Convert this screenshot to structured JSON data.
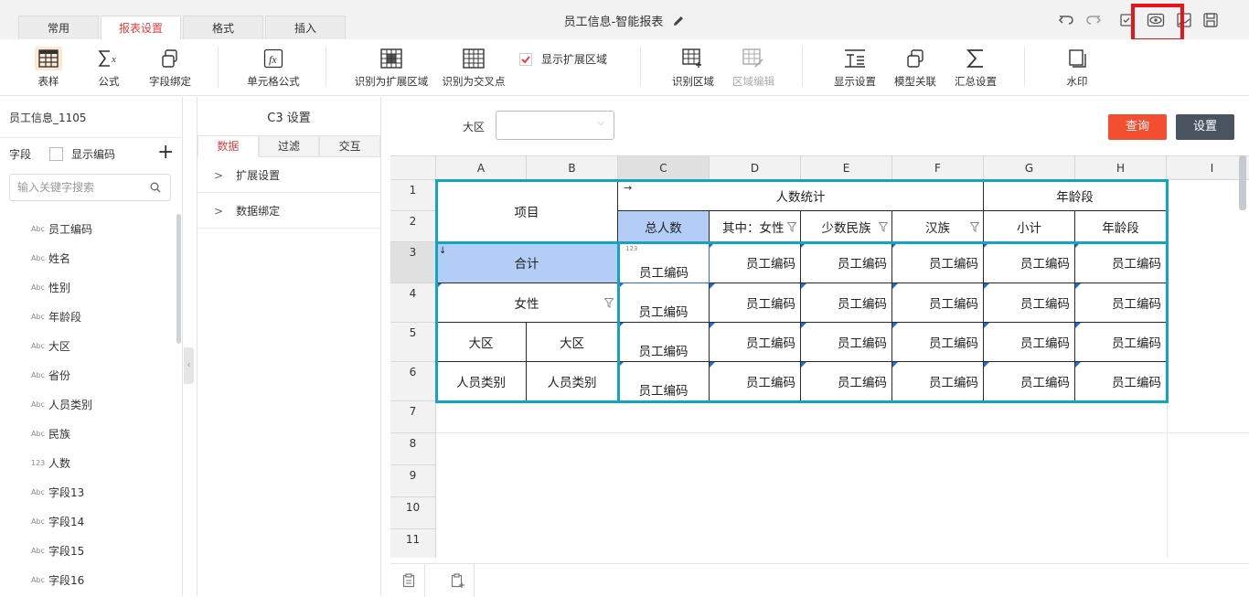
{
  "tabs": [
    {
      "label": "常用",
      "active": false
    },
    {
      "label": "报表设置",
      "active": true
    },
    {
      "label": "格式",
      "active": false
    },
    {
      "label": "插入",
      "active": false
    }
  ],
  "doc_title": "员工信息-智能报表",
  "top_right_icons": [
    "undo-icon",
    "redo-icon",
    "check-box-icon",
    "preview-eye-icon",
    "export-image-icon",
    "save-icon"
  ],
  "toolbar": {
    "items": [
      {
        "label": "表样",
        "icon": "table-style-icon"
      },
      {
        "label": "公式",
        "icon": "formula-icon"
      },
      {
        "label": "字段绑定",
        "icon": "field-bind-icon"
      },
      {
        "label": "单元格公式",
        "icon": "cell-formula-icon"
      },
      {
        "label": "识别为扩展区域",
        "icon": "expand-region-icon"
      },
      {
        "label": "识别为交叉点",
        "icon": "cross-point-icon"
      },
      {
        "label": "识别区域",
        "icon": "identify-region-icon"
      },
      {
        "label": "区域编辑",
        "icon": "region-edit-icon",
        "disabled": true
      },
      {
        "label": "显示设置",
        "icon": "display-settings-icon"
      },
      {
        "label": "模型关联",
        "icon": "model-link-icon"
      },
      {
        "label": "汇总设置",
        "icon": "summary-icon"
      },
      {
        "label": "水印",
        "icon": "watermark-icon"
      }
    ],
    "show_expand_area_label": "显示扩展区域",
    "show_expand_area_checked": true
  },
  "left_panel": {
    "title": "员工信息_1105",
    "field_label": "字段",
    "show_code_label": "显示编码",
    "search_placeholder": "输入关键字搜索",
    "fields": [
      {
        "type": "Abc",
        "name": "员工编码"
      },
      {
        "type": "Abc",
        "name": "姓名"
      },
      {
        "type": "Abc",
        "name": "性别"
      },
      {
        "type": "Abc",
        "name": "年龄段"
      },
      {
        "type": "Abc",
        "name": "大区"
      },
      {
        "type": "Abc",
        "name": "省份"
      },
      {
        "type": "Abc",
        "name": "人员类别"
      },
      {
        "type": "Abc",
        "name": "民族"
      },
      {
        "type": "123",
        "name": "人数"
      },
      {
        "type": "Abc",
        "name": "字段13"
      },
      {
        "type": "Abc",
        "name": "字段14"
      },
      {
        "type": "Abc",
        "name": "字段15"
      },
      {
        "type": "Abc",
        "name": "字段16"
      }
    ]
  },
  "mid_panel": {
    "title": "C3 设置",
    "tabs": [
      {
        "label": "数据",
        "active": true
      },
      {
        "label": "过滤",
        "active": false
      },
      {
        "label": "交互",
        "active": false
      }
    ],
    "sections": [
      "扩展设置",
      "数据绑定"
    ]
  },
  "filter": {
    "label": "大区",
    "value": ""
  },
  "buttons": {
    "query": "查询",
    "settings": "设置"
  },
  "sheet": {
    "columns": [
      "A",
      "B",
      "C",
      "D",
      "E",
      "F",
      "G",
      "H",
      "I"
    ],
    "rows": [
      "1",
      "2",
      "3",
      "4",
      "5",
      "6",
      "7",
      "8",
      "9",
      "10",
      "11"
    ],
    "cells": {
      "xiangmu": "项目",
      "renshu_tongji": "人数统计",
      "nianling_duan_hdr": "年龄段",
      "zong_renshu": "总人数",
      "qizhong_nvxing": "其中：女性",
      "shaoshu_minzu": "少数民族",
      "hanzu": "汉族",
      "xiaoji": "小计",
      "nianling_duan": "年龄段",
      "heji": "合计",
      "nvxing": "女性",
      "daqu_a": "大区",
      "daqu_b": "大区",
      "renyuan_leibie_a": "人员类别",
      "renyuan_leibie_b": "人员类别",
      "emp_code": "员工编码",
      "num_badge": "123"
    }
  }
}
